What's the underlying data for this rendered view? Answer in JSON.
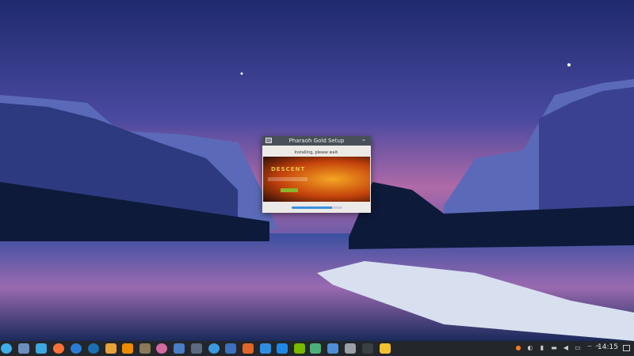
{
  "dialog": {
    "title": "Pharaoh Gold Setup",
    "message": "Installing, please wait.",
    "banner_logo": "DESCENT",
    "progress_percent": 80
  },
  "taskbar": {
    "launchers": [
      {
        "icon": "app-launcher-icon",
        "color": "#3daee9"
      },
      {
        "icon": "system-monitor-icon",
        "color": "#6c8ebf"
      },
      {
        "icon": "file-manager-icon",
        "color": "#3da7e0"
      },
      {
        "icon": "firefox-icon",
        "color": "#ff7139"
      },
      {
        "icon": "thunderbird-icon",
        "color": "#2b7bd6"
      },
      {
        "icon": "steam-icon",
        "color": "#1b6fb0"
      },
      {
        "icon": "wine-installer-icon",
        "color": "#e8a23a"
      },
      {
        "icon": "vlc-icon",
        "color": "#f08a00"
      },
      {
        "icon": "gimp-icon",
        "color": "#8a7a5a"
      },
      {
        "icon": "media-player-icon",
        "color": "#d36aa0"
      },
      {
        "icon": "libreoffice-icon",
        "color": "#4a7dc8"
      },
      {
        "icon": "davinci-resolve-icon",
        "color": "#5a6a80"
      },
      {
        "icon": "network-app-icon",
        "color": "#3a9ae0"
      },
      {
        "icon": "image-viewer-icon",
        "color": "#3c70c0"
      },
      {
        "icon": "impress-icon",
        "color": "#e0662a"
      },
      {
        "icon": "writer-icon",
        "color": "#2f8de0"
      },
      {
        "icon": "store-icon",
        "color": "#1e88e5"
      },
      {
        "icon": "nvidia-icon",
        "color": "#76b900"
      },
      {
        "icon": "chart-app-icon",
        "color": "#4caf7a"
      },
      {
        "icon": "calculator-icon",
        "color": "#4d8fd6"
      },
      {
        "icon": "settings-icon",
        "color": "#9aa0a6"
      },
      {
        "icon": "terminal-icon",
        "color": "#3a3f45"
      },
      {
        "icon": "setup-window-icon",
        "color": "#f2c230"
      }
    ],
    "tray": [
      {
        "icon": "updates-icon",
        "glyph": "●",
        "color": "#f47a20"
      },
      {
        "icon": "vault-icon",
        "glyph": "◐",
        "color": "#cccccc"
      },
      {
        "icon": "clipboard-icon",
        "glyph": "▮",
        "color": "#cccccc"
      },
      {
        "icon": "keyboard-icon",
        "glyph": "▬",
        "color": "#cccccc"
      },
      {
        "icon": "volume-icon",
        "glyph": "◀",
        "color": "#cccccc"
      },
      {
        "icon": "battery-icon",
        "glyph": "▭",
        "color": "#cccccc"
      },
      {
        "icon": "wifi-icon",
        "glyph": "⌔",
        "color": "#cccccc"
      },
      {
        "icon": "expand-tray-icon",
        "glyph": "^",
        "color": "#cccccc"
      }
    ],
    "clock": "14:15",
    "show_desktop_icon": "show-desktop-icon"
  }
}
